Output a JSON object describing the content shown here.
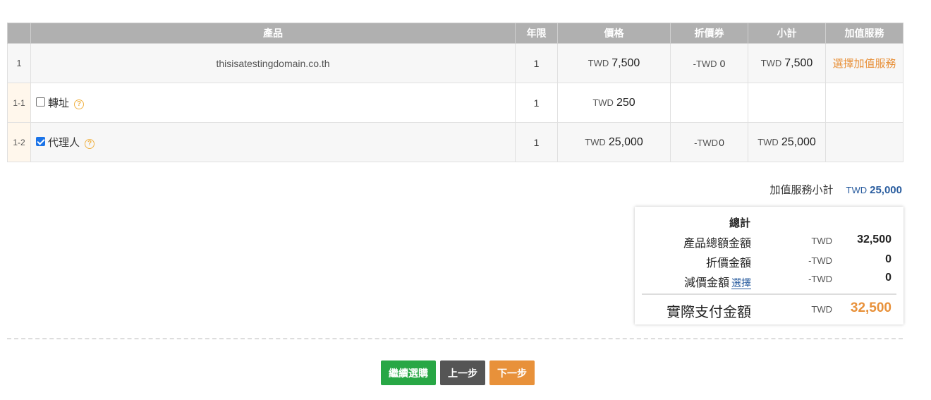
{
  "table": {
    "headers": [
      "",
      "產品",
      "年限",
      "價格",
      "折價券",
      "小計",
      "加值服務"
    ],
    "main_row": {
      "index": "1",
      "product": "thisisatestingdomain.co.th",
      "years": "1",
      "price_currency": "TWD",
      "price": "7,500",
      "coupon_currency": "-TWD",
      "coupon": "0",
      "subtotal_currency": "TWD",
      "subtotal": "7,500",
      "vas_link": "選擇加值服務"
    },
    "sub_rows": [
      {
        "index": "1-1",
        "checked": false,
        "label": "轉址",
        "years": "1",
        "price_currency": "TWD",
        "price": "250"
      },
      {
        "index": "1-2",
        "checked": true,
        "label": "代理人",
        "years": "1",
        "price_currency": "TWD",
        "price": "25,000",
        "coupon_currency": "-TWD",
        "coupon": "0",
        "subtotal_currency": "TWD",
        "subtotal": "25,000"
      }
    ]
  },
  "vas_subtotal": {
    "label": "加值服務小計",
    "currency": "TWD",
    "amount": "25,000"
  },
  "summary": {
    "title": "總計",
    "product_total_label": "產品總額金額",
    "product_total_currency": "TWD",
    "product_total": "32,500",
    "discount_label": "折價金額",
    "discount_currency": "-TWD",
    "discount": "0",
    "reduction_label": "減價金額",
    "reduction_link": "選擇",
    "reduction_currency": "-TWD",
    "reduction": "0",
    "pay_label": "實際支付金額",
    "pay_currency": "TWD",
    "pay": "32,500"
  },
  "buttons": {
    "continue": "繼續選購",
    "prev": "上一步",
    "next": "下一步"
  },
  "colors": {
    "header_bg": "#b0b0b0",
    "accent_orange": "#e8913a",
    "link_blue": "#2a5d9f",
    "green": "#28a745",
    "grey": "#555555",
    "help_icon": "#f0b347"
  }
}
